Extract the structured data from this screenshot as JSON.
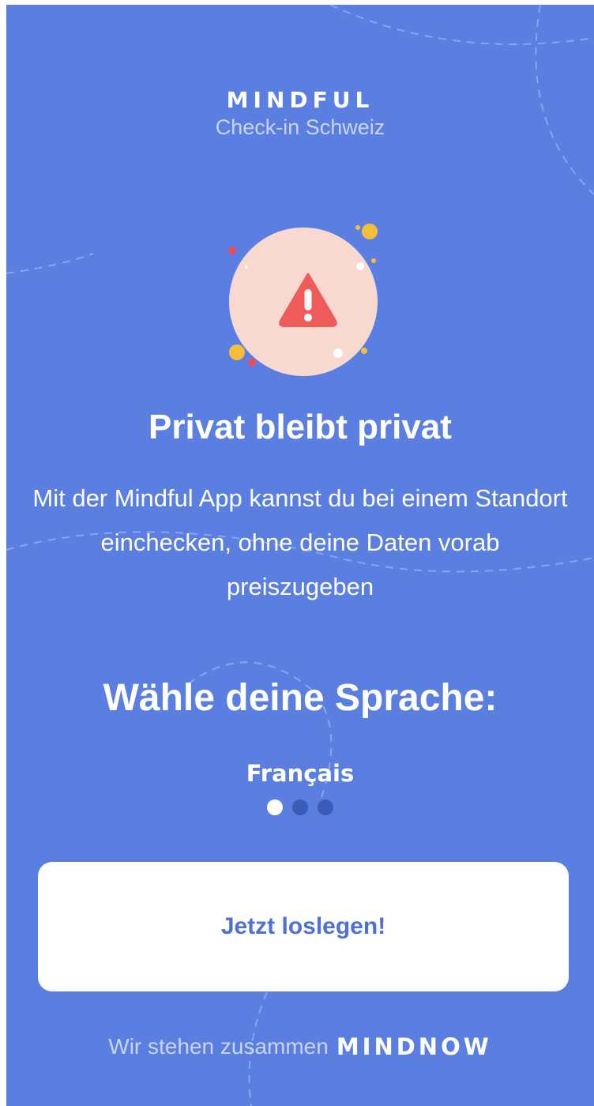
{
  "header": {
    "brand": "MINDFUL",
    "subtitle": "Check-in Schweiz"
  },
  "illustration": {
    "icon": "warning-triangle-icon",
    "circle_color": "#f8d9d0",
    "icon_color": "#ef5b5b"
  },
  "intro": {
    "headline": "Privat bleibt privat",
    "description": "Mit der Mindful App kannst du bei einem Standort einchecken, ohne deine Daten vorab preiszugeben"
  },
  "language": {
    "title": "Wähle deine Sprache:",
    "selected": "Français",
    "options_count": 3,
    "active_index": 0
  },
  "cta": {
    "label": "Jetzt loslegen!"
  },
  "footer": {
    "text": "Wir stehen zusammen",
    "partner": "MINDNOW"
  },
  "colors": {
    "background": "#5b7fe1",
    "button_background": "#ffffff",
    "button_text": "#4f70d4",
    "dot_inactive": "#3c5bb7",
    "dot_active": "#ffffff"
  }
}
